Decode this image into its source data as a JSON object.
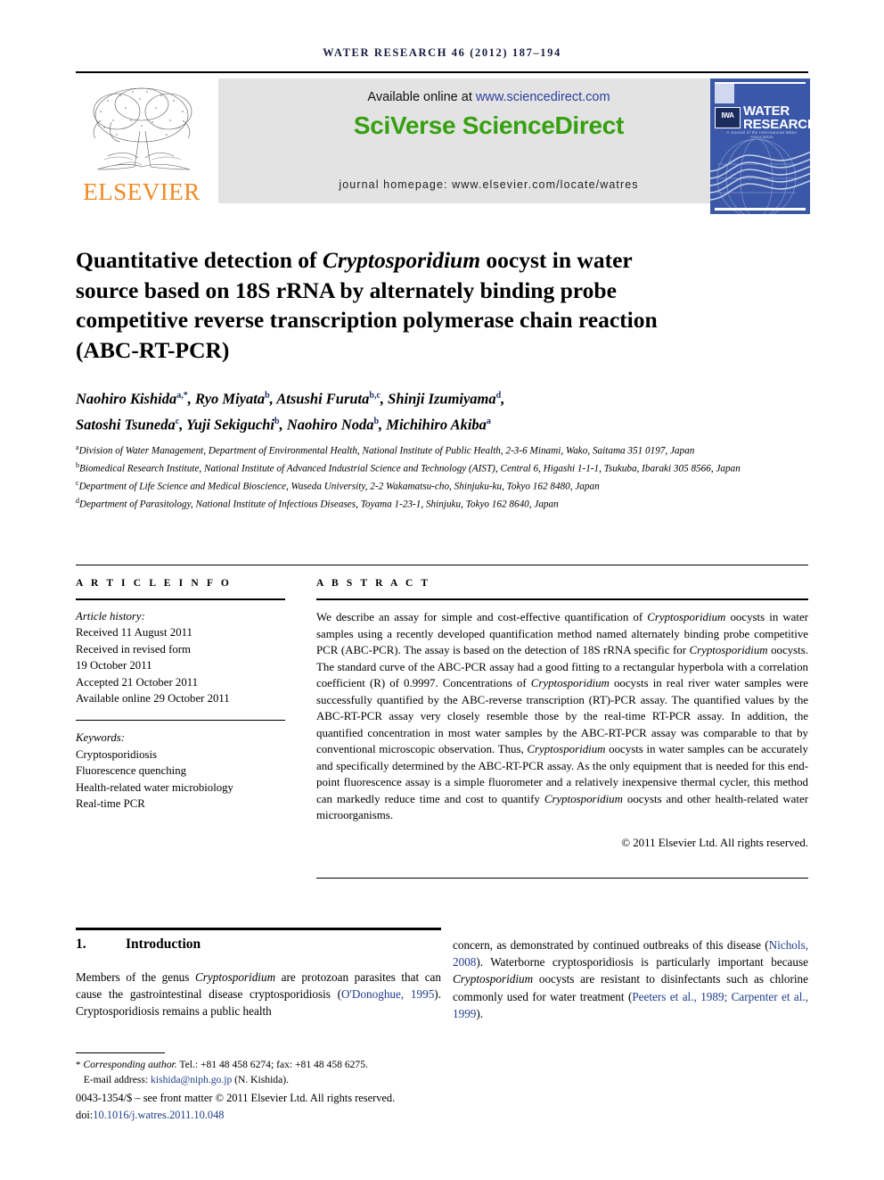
{
  "running_head": "WATER RESEARCH 46 (2012) 187–194",
  "masthead": {
    "publisher_logo_name": "ELSEVIER",
    "available_prefix": "Available online at ",
    "available_link": "www.sciencedirect.com",
    "platform_brand": "SciVerse ScienceDirect",
    "journal_homepage": "journal homepage: www.elsevier.com/locate/watres",
    "cover": {
      "line1": "WATER",
      "line2": "RESEARCH",
      "society_mark": "IWA",
      "strapline": "A Journal of the International Water Association"
    },
    "brand_green": "#36a010",
    "link_blue": "#2b3f9e",
    "elsevier_orange": "#f08a24",
    "cover_blue": "#3a57a8"
  },
  "article": {
    "title_line1_a": "Quantitative detection of ",
    "title_line1_italic": "Cryptosporidium",
    "title_line1_b": " oocyst in water",
    "title_line2": "source based on 18S rRNA by alternately binding probe",
    "title_line3": "competitive reverse transcription polymerase chain reaction",
    "title_line4": "(ABC-RT-PCR)",
    "authors_line1": "Naohiro Kishida",
    "authors": [
      {
        "name": "Naohiro Kishida",
        "sup": "a,*"
      },
      {
        "name": "Ryo Miyata",
        "sup": "b"
      },
      {
        "name": "Atsushi Furuta",
        "sup": "b,c"
      },
      {
        "name": "Shinji Izumiyama",
        "sup": "d"
      },
      {
        "name": "Satoshi Tsuneda",
        "sup": "c"
      },
      {
        "name": "Yuji Sekiguchi",
        "sup": "b"
      },
      {
        "name": "Naohiro Noda",
        "sup": "b"
      },
      {
        "name": "Michihiro Akiba",
        "sup": "a"
      }
    ],
    "affiliations": [
      {
        "mark": "a",
        "text": "Division of Water Management, Department of Environmental Health, National Institute of Public Health, 2-3-6 Minami, Wako, Saitama 351 0197, Japan"
      },
      {
        "mark": "b",
        "text": "Biomedical Research Institute, National Institute of Advanced Industrial Science and Technology (AIST), Central 6, Higashi 1-1-1, Tsukuba, Ibaraki 305 8566, Japan"
      },
      {
        "mark": "c",
        "text": "Department of Life Science and Medical Bioscience, Waseda University, 2-2 Wakamatsu-cho, Shinjuku-ku, Tokyo 162 8480, Japan"
      },
      {
        "mark": "d",
        "text": "Department of Parasitology, National Institute of Infectious Diseases, Toyama 1-23-1, Shinjuku, Tokyo 162 8640, Japan"
      }
    ]
  },
  "article_info": {
    "heading": "A R T I C L E   I N F O",
    "history_label": "Article history:",
    "history": [
      "Received 11 August 2011",
      "Received in revised form",
      "19 October 2011",
      "Accepted 21 October 2011",
      "Available online 29 October 2011"
    ],
    "keywords_label": "Keywords:",
    "keywords": [
      "Cryptosporidiosis",
      "Fluorescence quenching",
      "Health-related water microbiology",
      "Real-time PCR"
    ]
  },
  "abstract": {
    "heading": "A B S T R A C T",
    "p1_a": "We describe an assay for simple and cost-effective quantification of ",
    "p1_i1": "Cryptosporidium",
    "p1_b": " oocysts in water samples using a recently developed quantification method named alternately binding probe competitive PCR (ABC-PCR). The assay is based on the detection of 18S rRNA specific for ",
    "p1_i2": "Cryptosporidium",
    "p1_c": " oocysts. The standard curve of the ABC-PCR assay had a good fitting to a rectangular hyperbola with a correlation coefficient (R) of 0.9997. Concentrations of ",
    "p1_i3": "Cryptosporidium",
    "p1_d": " oocysts in real river water samples were successfully quantified by the ABC-reverse transcription (RT)-PCR assay. The quantified values by the ABC-RT-PCR assay very closely resemble those by the real-time RT-PCR assay. In addition, the quantified concentration in most water samples by the ABC-RT-PCR assay was comparable to that by conventional microscopic observation. Thus, ",
    "p1_i4": "Cryptosporidium",
    "p1_e": " oocysts in water samples can be accurately and specifically determined by the ABC-RT-PCR assay. As the only equipment that is needed for this end-point fluorescence assay is a simple fluorometer and a relatively inexpensive thermal cycler, this method can markedly reduce time and cost to quantify ",
    "p1_i5": "Cryptosporidium",
    "p1_f": " oocysts and other health-related water microorganisms.",
    "copyright": "© 2011 Elsevier Ltd. All rights reserved."
  },
  "introduction": {
    "number": "1.",
    "heading": "Introduction",
    "left_a": "Members of the genus ",
    "left_i1": "Cryptosporidium",
    "left_b": " are protozoan parasites that can cause the gastrointestinal disease cryptosporidiosis (",
    "left_ref1": "O'Donoghue, 1995",
    "left_c": "). Cryptosporidiosis remains a public health",
    "right_a": "concern, as demonstrated by continued outbreaks of this disease (",
    "right_ref1": "Nichols, 2008",
    "right_b": "). Waterborne cryptosporidiosis is particularly important because ",
    "right_i1": "Cryptosporidium",
    "right_c": " oocysts are resistant to disinfectants such as chlorine commonly used for water treatment (",
    "right_ref2": "Peeters et al., 1989; Carpenter et al., 1999",
    "right_d": ")."
  },
  "footer": {
    "star": "*",
    "corr_label": "Corresponding author.",
    "corr_tel": " Tel.: +81 48 458 6274; fax: +81 48 458 6275.",
    "email_label": "E-mail address: ",
    "email": "kishida@niph.go.jp",
    "email_owner": " (N. Kishida).",
    "frontmatter": "0043-1354/$ – see front matter © 2011 Elsevier Ltd. All rights reserved.",
    "doi_label": "doi:",
    "doi": "10.1016/j.watres.2011.10.048"
  }
}
